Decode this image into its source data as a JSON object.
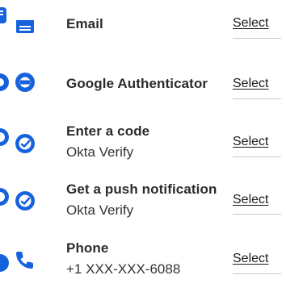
{
  "factors": [
    {
      "icon": "email-icon",
      "title": "Email",
      "subtitle": "",
      "action": "Select"
    },
    {
      "icon": "google-authenticator-icon",
      "title": "Google Authenticator",
      "subtitle": "",
      "action": "Select"
    },
    {
      "icon": "okta-verify-icon",
      "title": "Enter a code",
      "subtitle": "Okta Verify",
      "action": "Select"
    },
    {
      "icon": "okta-verify-icon",
      "title": "Get a push notification",
      "subtitle": "Okta Verify",
      "action": "Select"
    },
    {
      "icon": "phone-icon",
      "title": "Phone",
      "subtitle": "+1 XXX-XXX-6088",
      "action": "Select"
    }
  ],
  "colors": {
    "icon_blue": "#1662dd",
    "icon_light": "#ffffff"
  }
}
